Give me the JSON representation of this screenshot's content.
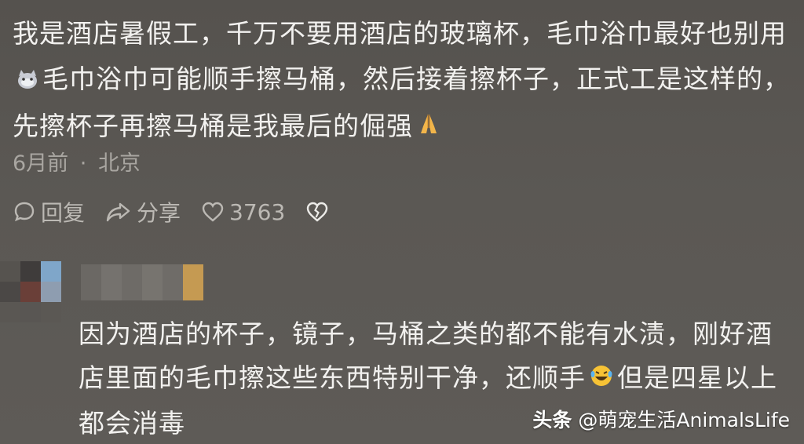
{
  "comment": {
    "text_part1": "我是酒店暑假工，千万不要用酒店的玻璃杯，毛巾浴巾最好也别用",
    "text_part2": "毛巾浴巾可能顺手擦马桶，然后接着擦杯子，正式工是这样的，先擦杯子再擦马桶是我最后的倔强",
    "emoji1": "cat-face-emoji",
    "emoji2": "pray-hands-emoji",
    "time": "6月前",
    "separator": "·",
    "location": "北京"
  },
  "actions": {
    "reply_label": "回复",
    "share_label": "分享",
    "like_count": "3763"
  },
  "reply": {
    "text_part1": "因为酒店的杯子，镜子，马桶之类的都不能有水渍，刚好酒店里面的毛巾擦这些东西特别干净，还顺手",
    "text_part2": "但是四星以上都会消毒",
    "emoji": "laughing-tears-emoji"
  },
  "watermark": {
    "brand": "头条",
    "account": "@萌宠生活AnimalsLife"
  },
  "colors": {
    "background": "#5a5753",
    "text": "#f2f1ef",
    "meta": "#a9a6a1"
  }
}
